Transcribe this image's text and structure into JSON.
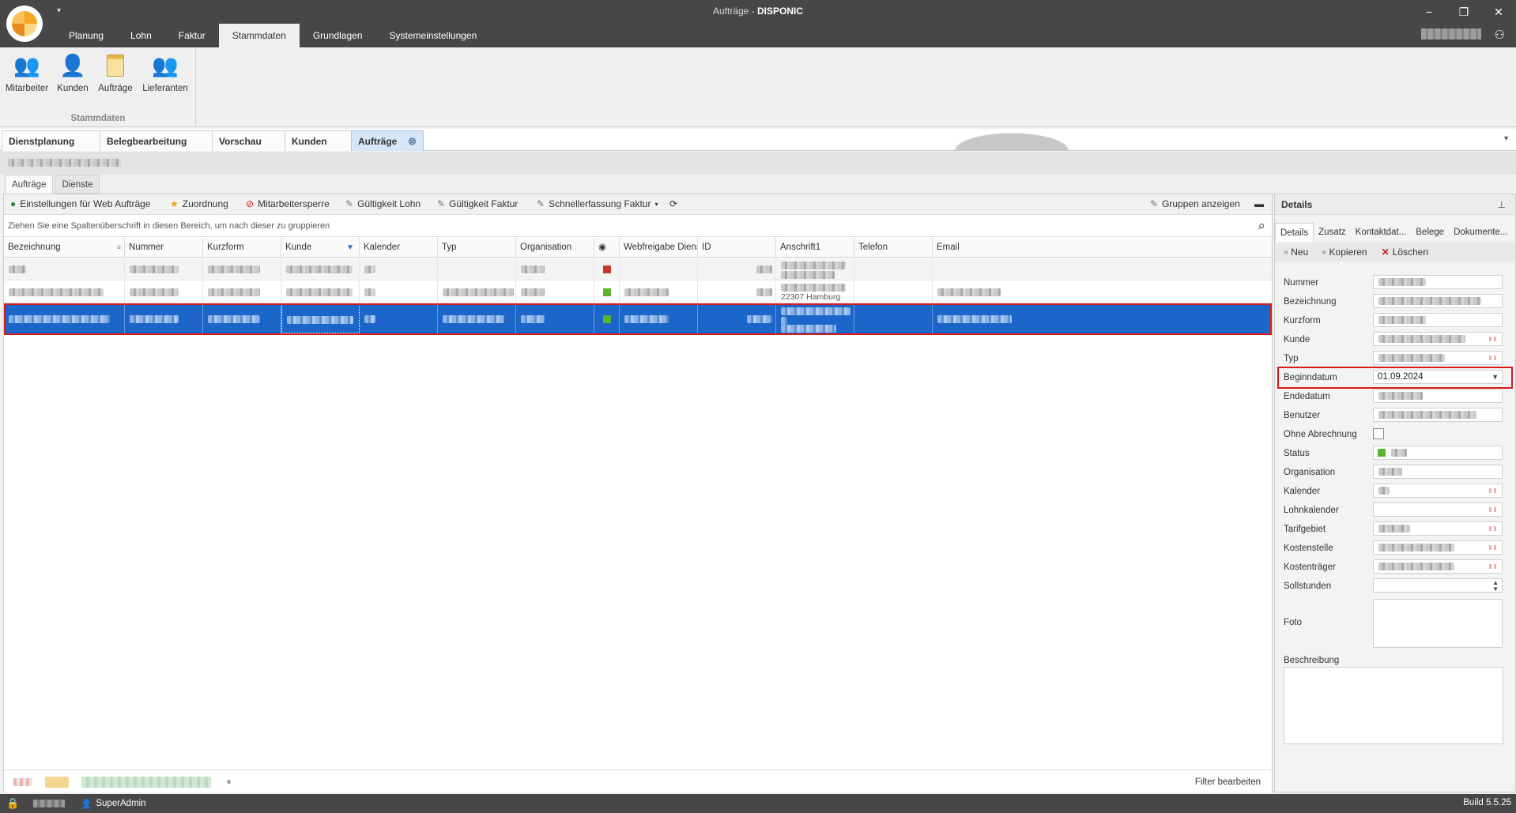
{
  "window": {
    "title_prefix": "Aufträge - ",
    "title_app": "DISPONIC",
    "minimize": "−",
    "restore": "❐",
    "close": "✕",
    "qa_arrow": "▾"
  },
  "ribbon_tabs": [
    "Planung",
    "Lohn",
    "Faktur",
    "Stammdaten",
    "Grundlagen",
    "Systemeinstellungen"
  ],
  "ribbon": {
    "group_label": "Stammdaten",
    "buttons": [
      {
        "label": "Mitarbeiter",
        "icon": "employees-icon"
      },
      {
        "label": "Kunden",
        "icon": "customer-icon"
      },
      {
        "label": "Aufträge",
        "icon": "orders-icon"
      },
      {
        "label": "Lieferanten",
        "icon": "suppliers-icon"
      }
    ]
  },
  "doc_tabs": [
    "Dienstplanung",
    "Belegbearbeitung",
    "Vorschau",
    "Kunden",
    "Aufträge"
  ],
  "inner_tabs": [
    "Aufträge",
    "Dienste"
  ],
  "toolbar": {
    "web_settings": "Einstellungen für Web Aufträge",
    "zuordnung": "Zuordnung",
    "sperre": "Mitarbeitersperre",
    "gueltigkeit_lohn": "Gültigkeit Lohn",
    "gueltigkeit_faktur": "Gültigkeit Faktur",
    "schnellerfassung": "Schnellerfassung Faktur",
    "gruppen": "Gruppen anzeigen"
  },
  "grouping_hint": "Ziehen Sie eine Spaltenüberschrift in diesen Bereich, um nach dieser zu gruppieren",
  "grid": {
    "columns": [
      "Bezeichnung",
      "Nummer",
      "Kurzform",
      "Kunde",
      "Kalender",
      "Typ",
      "Organisation",
      "◉",
      "Webfreigabe Dienst...",
      "ID",
      "Anschrift1",
      "Telefon",
      "Email"
    ],
    "visible_text": {
      "row2_anschrift": "22307 Hamburg"
    }
  },
  "filterbar": {
    "edit_filter": "Filter bearbeiten"
  },
  "details": {
    "title": "Details",
    "pin": "⊥",
    "tabs": [
      "Details",
      "Zusatz",
      "Kontaktdat...",
      "Belege",
      "Dokumente..."
    ],
    "actions": {
      "neu": "Neu",
      "kopieren": "Kopieren",
      "loeschen": "Löschen"
    },
    "fields": {
      "nummer": "Nummer",
      "bezeichnung": "Bezeichnung",
      "kurzform": "Kurzform",
      "kunde": "Kunde",
      "typ": "Typ",
      "beginndatum": "Beginndatum",
      "beginndatum_value": "01.09.2024",
      "endedatum": "Endedatum",
      "benutzer": "Benutzer",
      "ohne_abrechnung": "Ohne Abrechnung",
      "status": "Status",
      "organisation": "Organisation",
      "kalender": "Kalender",
      "lohnkalender": "Lohnkalender",
      "tarifgebiet": "Tarifgebiet",
      "kostenstelle": "Kostenstelle",
      "kostentraeger": "Kostenträger",
      "sollstunden": "Sollstunden",
      "foto": "Foto",
      "beschreibung": "Beschreibung"
    }
  },
  "statusbar": {
    "user": "SuperAdmin",
    "build": "Build 5.5.25"
  },
  "colors": {
    "selection": "#1c66c9",
    "highlight": "#d51b1b",
    "titlebar": "#474747"
  }
}
